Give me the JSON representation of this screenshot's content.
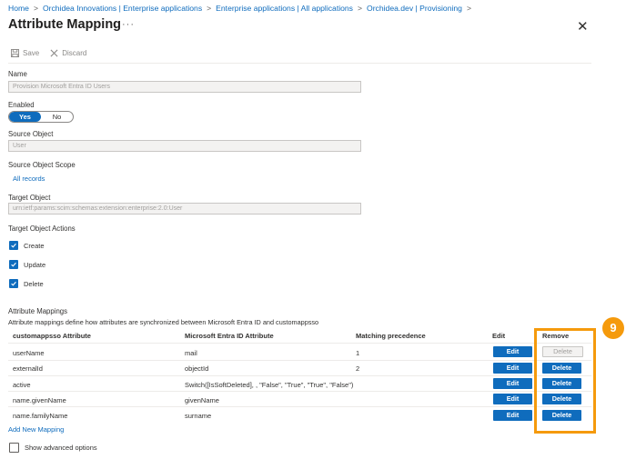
{
  "breadcrumb": [
    "Home",
    "Orchidea Innovations | Enterprise applications",
    "Enterprise applications | All applications",
    "Orchidea.dev | Provisioning"
  ],
  "title": "Attribute Mapping",
  "toolbar": {
    "save_label": "Save",
    "discard_label": "Discard"
  },
  "form": {
    "name_label": "Name",
    "name_value": "Provision Microsoft Entra ID Users",
    "enabled_label": "Enabled",
    "yes_label": "Yes",
    "no_label": "No",
    "source_object_label": "Source Object",
    "source_object_value": "User",
    "source_scope_label": "Source Object Scope",
    "source_scope_link": "All records",
    "target_object_label": "Target Object",
    "target_object_value": "urn:ietf:params:scim:schemas:extension:enterprise:2.0:User",
    "target_actions_label": "Target Object Actions",
    "actions": [
      "Create",
      "Update",
      "Delete"
    ]
  },
  "mappings": {
    "heading": "Attribute Mappings",
    "description": "Attribute mappings define how attributes are synchronized between Microsoft Entra ID and customappsso",
    "columns": [
      "customappsso Attribute",
      "Microsoft Entra ID Attribute",
      "Matching precedence",
      "Edit",
      "Remove"
    ],
    "rows": [
      {
        "target": "userName",
        "source": "mail",
        "precedence": "1"
      },
      {
        "target": "externalId",
        "source": "objectId",
        "precedence": "2"
      },
      {
        "target": "active",
        "source": "Switch([IsSoftDeleted], , \"False\", \"True\", \"True\", \"False\")",
        "precedence": ""
      },
      {
        "target": "name.givenName",
        "source": "givenName",
        "precedence": ""
      },
      {
        "target": "name.familyName",
        "source": "surname",
        "precedence": ""
      }
    ],
    "edit_label": "Edit",
    "delete_label": "Delete",
    "add_link": "Add New Mapping",
    "advanced_label": "Show advanced options"
  },
  "annotation": {
    "badge_number": "9",
    "color": "#f59a0c"
  },
  "colors": {
    "accent": "#0f6cbd"
  }
}
